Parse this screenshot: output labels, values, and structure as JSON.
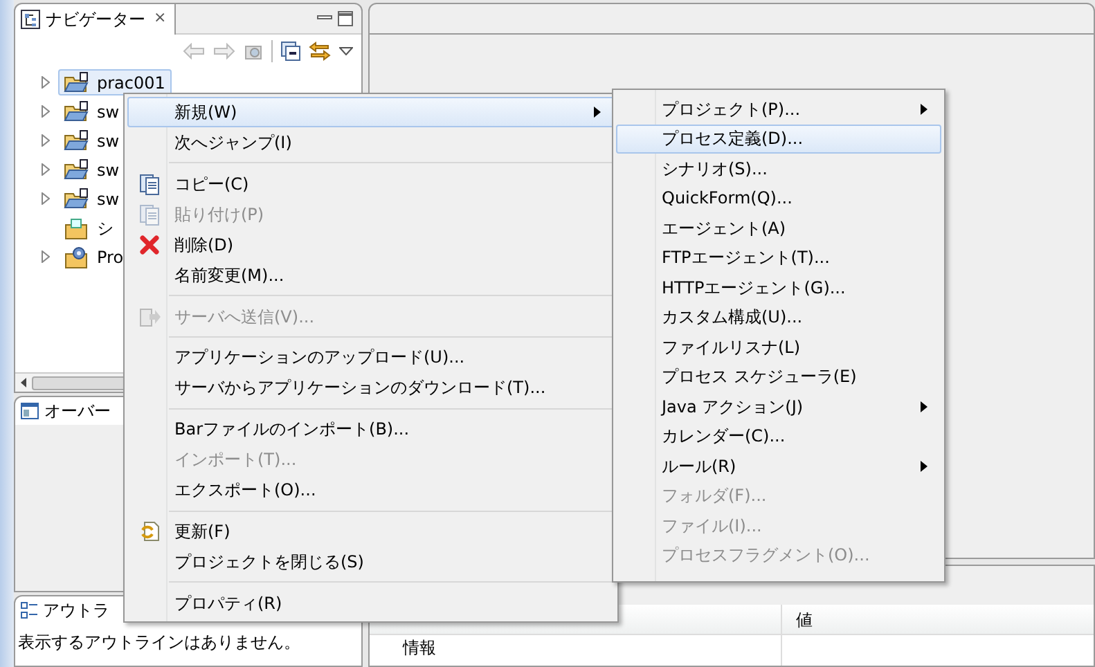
{
  "navigator": {
    "title": "ナビゲーター",
    "close": "×",
    "items": [
      {
        "label": "prac001",
        "expandable": true,
        "selected": true
      },
      {
        "label": "sw",
        "expandable": true,
        "selected": false
      },
      {
        "label": "sw",
        "expandable": true,
        "selected": false
      },
      {
        "label": "sw",
        "expandable": true,
        "selected": false
      },
      {
        "label": "sw",
        "expandable": true,
        "selected": false
      },
      {
        "label": "シ",
        "expandable": false,
        "selected": false
      },
      {
        "label": "Pro",
        "expandable": true,
        "selected": false
      }
    ]
  },
  "overview": {
    "title": "オーバー"
  },
  "outline": {
    "title": "アウトラ",
    "message": "表示するアウトラインはありません。"
  },
  "properties": {
    "column_2": "値",
    "rows": [
      {
        "label": "情報"
      }
    ]
  },
  "context_menu": {
    "items": [
      {
        "kind": "item",
        "label": "新規(W)",
        "selected": true,
        "disabled": false,
        "submenu": true
      },
      {
        "kind": "item",
        "label": "次へジャンプ(I)",
        "selected": false,
        "disabled": false,
        "submenu": false
      },
      {
        "kind": "separator"
      },
      {
        "kind": "item",
        "label": "コピー(C)",
        "selected": false,
        "disabled": false,
        "submenu": false
      },
      {
        "kind": "item",
        "label": "貼り付け(P)",
        "selected": false,
        "disabled": true,
        "submenu": false
      },
      {
        "kind": "item",
        "label": "削除(D)",
        "selected": false,
        "disabled": false,
        "submenu": false
      },
      {
        "kind": "item",
        "label": "名前変更(M)...",
        "selected": false,
        "disabled": false,
        "submenu": false
      },
      {
        "kind": "separator"
      },
      {
        "kind": "item",
        "label": "サーバへ送信(V)...",
        "selected": false,
        "disabled": true,
        "submenu": false
      },
      {
        "kind": "separator"
      },
      {
        "kind": "item",
        "label": "アプリケーションのアップロード(U)...",
        "selected": false,
        "disabled": false,
        "submenu": false
      },
      {
        "kind": "item",
        "label": "サーバからアプリケーションのダウンロード(T)...",
        "selected": false,
        "disabled": false,
        "submenu": false
      },
      {
        "kind": "separator"
      },
      {
        "kind": "item",
        "label": "Barファイルのインポート(B)...",
        "selected": false,
        "disabled": false,
        "submenu": false
      },
      {
        "kind": "item",
        "label": "インポート(T)...",
        "selected": false,
        "disabled": true,
        "submenu": false
      },
      {
        "kind": "item",
        "label": "エクスポート(O)...",
        "selected": false,
        "disabled": false,
        "submenu": false
      },
      {
        "kind": "separator"
      },
      {
        "kind": "item",
        "label": "更新(F)",
        "selected": false,
        "disabled": false,
        "submenu": false
      },
      {
        "kind": "item",
        "label": "プロジェクトを閉じる(S)",
        "selected": false,
        "disabled": false,
        "submenu": false
      },
      {
        "kind": "separator"
      },
      {
        "kind": "item",
        "label": "プロパティ(R)",
        "selected": false,
        "disabled": false,
        "submenu": false
      }
    ]
  },
  "submenu": {
    "items": [
      {
        "label": "プロジェクト(P)...",
        "selected": false,
        "disabled": false,
        "submenu": true
      },
      {
        "label": "プロセス定義(D)...",
        "selected": true,
        "disabled": false,
        "submenu": false
      },
      {
        "label": "シナリオ(S)...",
        "selected": false,
        "disabled": false,
        "submenu": false
      },
      {
        "label": "QuickForm(Q)...",
        "selected": false,
        "disabled": false,
        "submenu": false
      },
      {
        "label": "エージェント(A)",
        "selected": false,
        "disabled": false,
        "submenu": false
      },
      {
        "label": "FTPエージェント(T)...",
        "selected": false,
        "disabled": false,
        "submenu": false
      },
      {
        "label": "HTTPエージェント(G)...",
        "selected": false,
        "disabled": false,
        "submenu": false
      },
      {
        "label": "カスタム構成(U)...",
        "selected": false,
        "disabled": false,
        "submenu": false
      },
      {
        "label": "ファイルリスナ(L)",
        "selected": false,
        "disabled": false,
        "submenu": false
      },
      {
        "label": "プロセス スケジューラ(E)",
        "selected": false,
        "disabled": false,
        "submenu": false
      },
      {
        "label": "Java アクション(J)",
        "selected": false,
        "disabled": false,
        "submenu": true
      },
      {
        "label": "カレンダー(C)...",
        "selected": false,
        "disabled": false,
        "submenu": false
      },
      {
        "label": "ルール(R)",
        "selected": false,
        "disabled": false,
        "submenu": true
      },
      {
        "label": "フォルダ(F)...",
        "selected": false,
        "disabled": true,
        "submenu": false
      },
      {
        "label": "ファイル(I)...",
        "selected": false,
        "disabled": true,
        "submenu": false
      },
      {
        "label": "プロセスフラグメント(O)...",
        "selected": false,
        "disabled": true,
        "submenu": false
      }
    ]
  }
}
